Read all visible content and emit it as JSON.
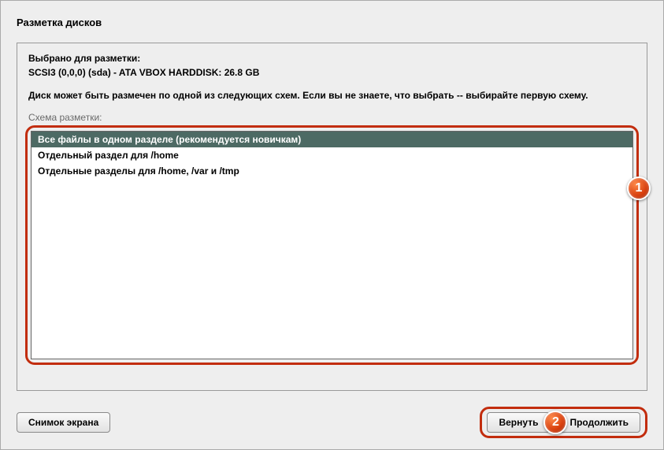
{
  "title": "Разметка дисков",
  "selected_label": "Выбрано для разметки:",
  "disk": "SCSI3 (0,0,0) (sda) - ATA VBOX HARDDISK: 26.8 GB",
  "hint": "Диск может быть размечен по одной из следующих схем. Если вы не знаете, что выбрать -- выбирайте первую схему.",
  "scheme_label": "Схема разметки:",
  "options": [
    "Все файлы в одном разделе (рекомендуется новичкам)",
    "Отдельный раздел для /home",
    "Отдельные разделы для /home, /var и /tmp"
  ],
  "selected_index": 0,
  "buttons": {
    "screenshot": "Снимок экрана",
    "back": "Вернуть",
    "continue": "Продолжить"
  },
  "annotations": {
    "one": "1",
    "two": "2"
  }
}
